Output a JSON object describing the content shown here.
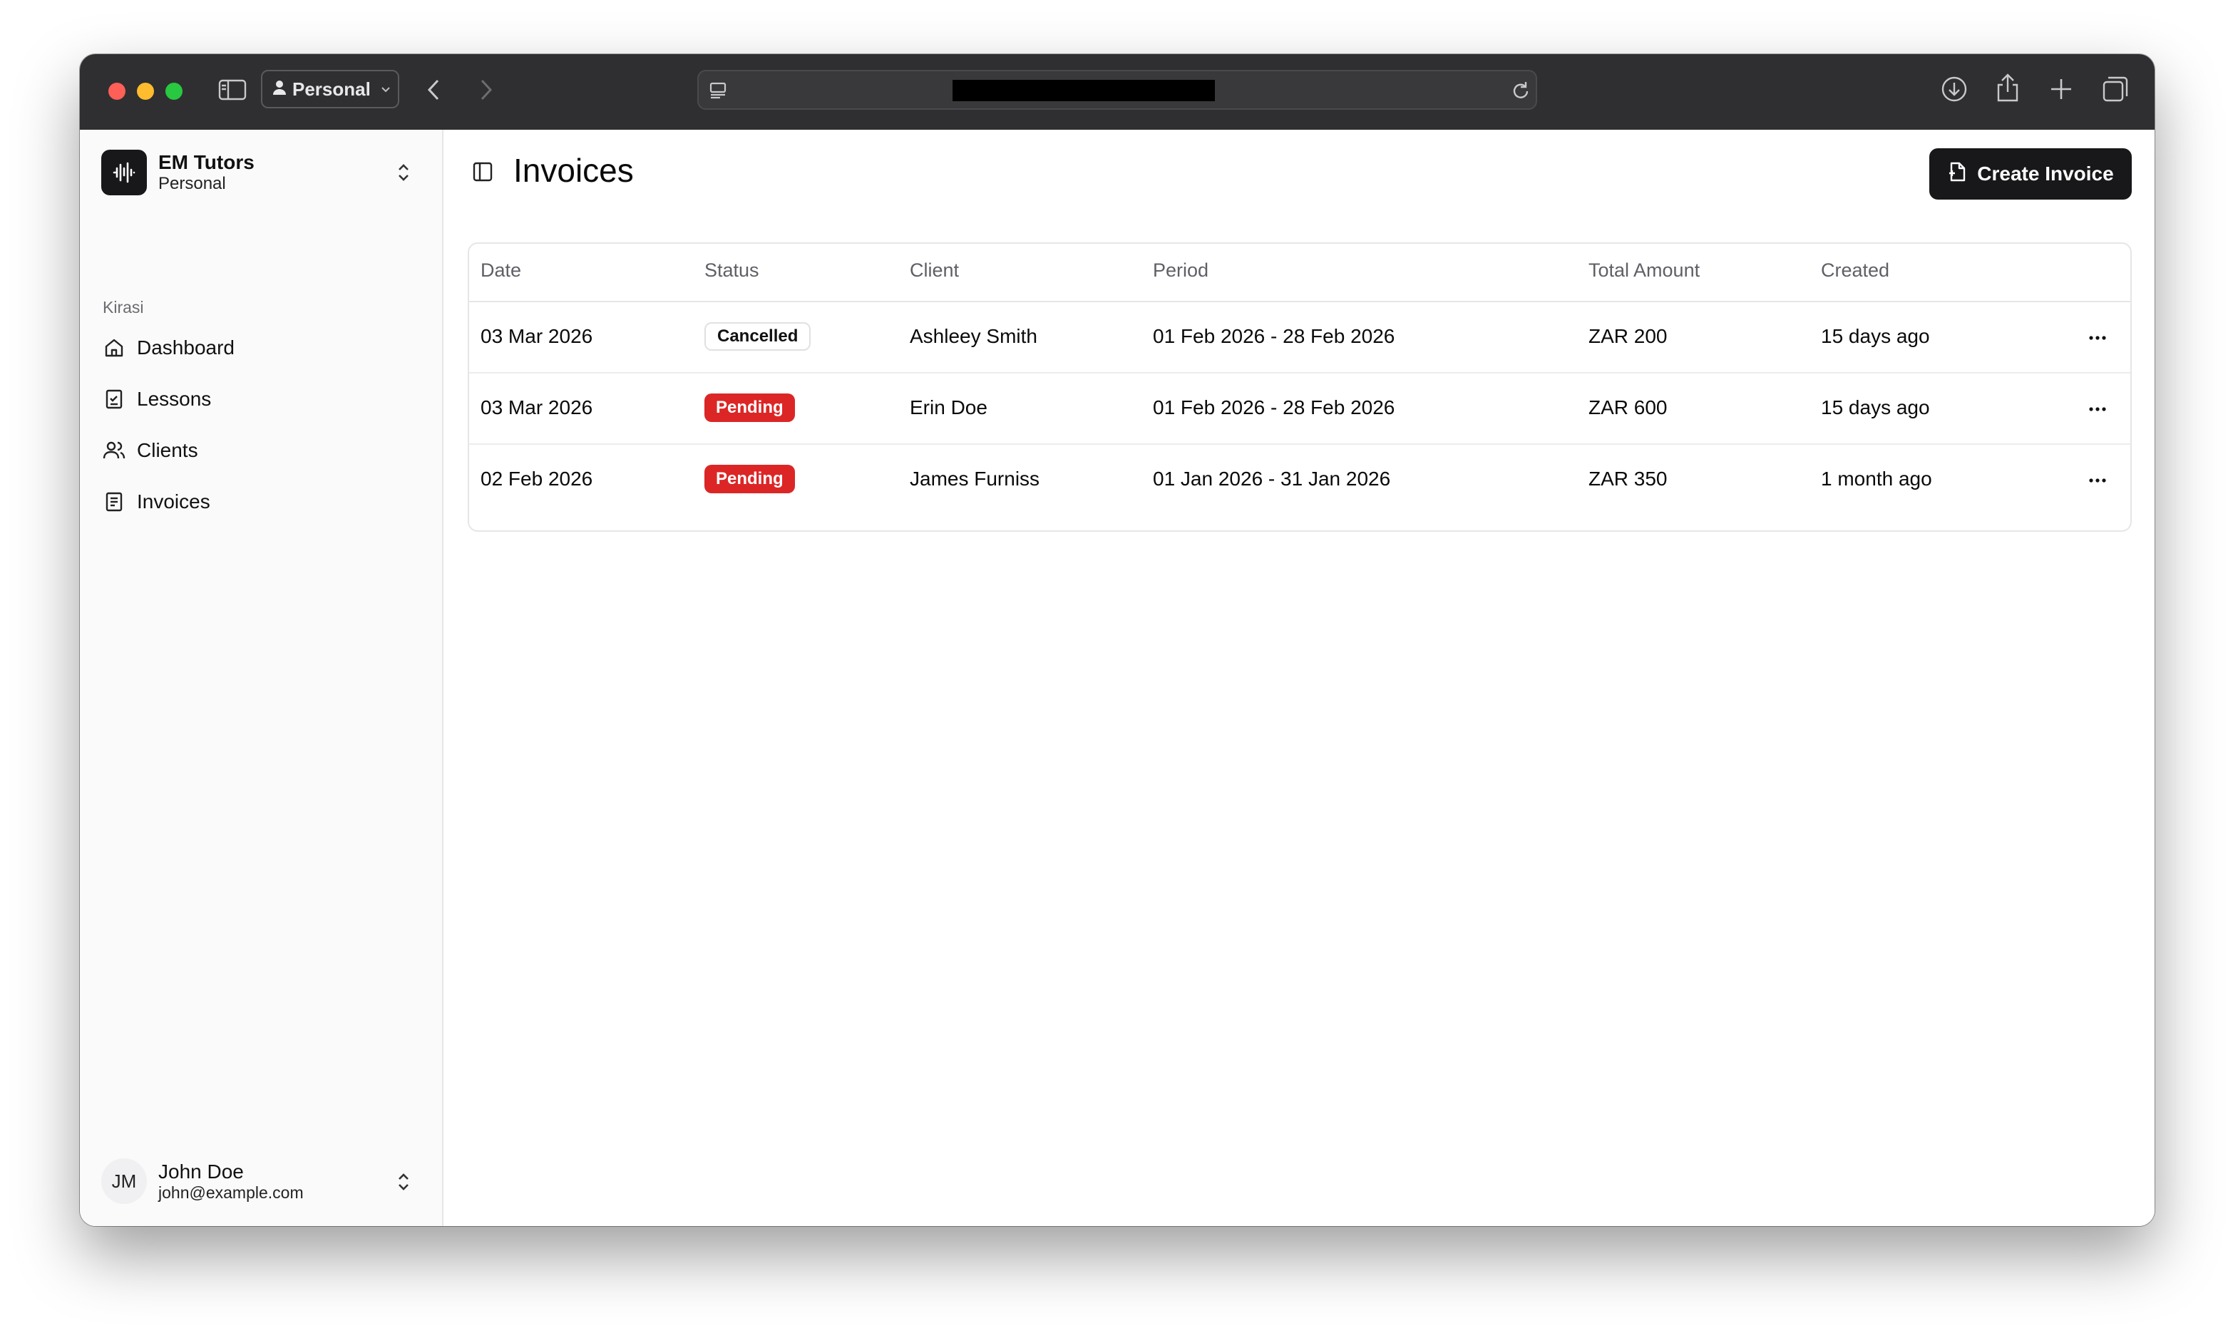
{
  "browser": {
    "profile_label": "Personal",
    "url": ""
  },
  "sidebar": {
    "org": {
      "name": "EM Tutors",
      "subtitle": "Personal"
    },
    "group_label": "Kirasi",
    "items": [
      {
        "label": "Dashboard",
        "icon": "home-icon"
      },
      {
        "label": "Lessons",
        "icon": "checklist-icon"
      },
      {
        "label": "Clients",
        "icon": "users-icon"
      },
      {
        "label": "Invoices",
        "icon": "document-icon"
      }
    ],
    "user": {
      "initials": "JM",
      "name": "John Doe",
      "email": "john@example.com"
    }
  },
  "main": {
    "title": "Invoices",
    "create_label": "Create Invoice",
    "columns": [
      "Date",
      "Status",
      "Client",
      "Period",
      "Total Amount",
      "Created"
    ],
    "rows": [
      {
        "date": "03 Mar 2026",
        "status": "Cancelled",
        "client": "Ashleey Smith",
        "period": "01 Feb 2026 - 28 Feb 2026",
        "amount": "ZAR 200",
        "created": "15 days ago"
      },
      {
        "date": "03 Mar 2026",
        "status": "Pending",
        "client": "Erin Doe",
        "period": "01 Feb 2026 - 28 Feb 2026",
        "amount": "ZAR 600",
        "created": "15 days ago"
      },
      {
        "date": "02 Feb 2026",
        "status": "Pending",
        "client": "James Furniss",
        "period": "01 Jan 2026 - 31 Jan 2026",
        "amount": "ZAR 350",
        "created": "1 month ago"
      }
    ]
  },
  "colors": {
    "accent_dark": "#18181b",
    "status_pending": "#dc2626",
    "chrome": "#2f2f31"
  }
}
